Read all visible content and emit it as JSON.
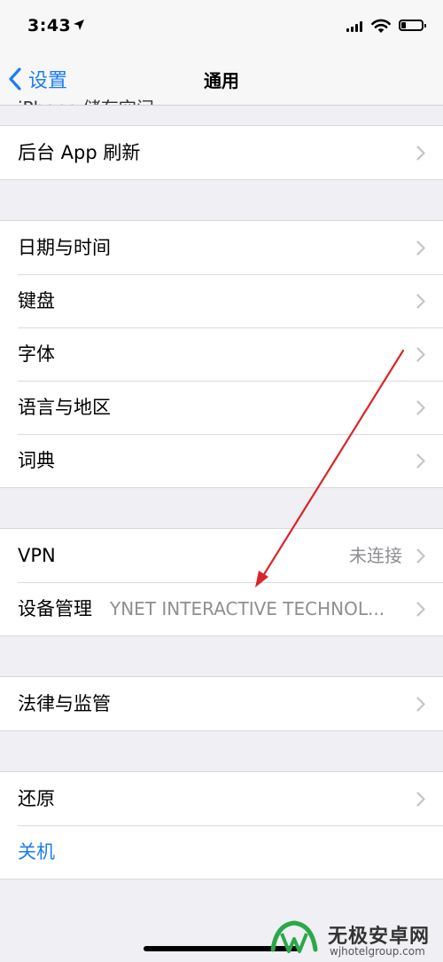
{
  "status_bar": {
    "time": "3:43"
  },
  "nav": {
    "back_label": "设置",
    "title": "通用",
    "clipped_item": "iPhone 储存空间"
  },
  "groups": [
    {
      "rows": [
        {
          "label": "后台 App 刷新",
          "value": ""
        }
      ]
    },
    {
      "rows": [
        {
          "label": "日期与时间",
          "value": ""
        },
        {
          "label": "键盘",
          "value": ""
        },
        {
          "label": "字体",
          "value": ""
        },
        {
          "label": "语言与地区",
          "value": ""
        },
        {
          "label": "词典",
          "value": ""
        }
      ]
    },
    {
      "rows": [
        {
          "label": "VPN",
          "value": "未连接"
        },
        {
          "label": "设备管理",
          "value": "YNET INTERACTIVE TECHNOL..."
        }
      ]
    },
    {
      "rows": [
        {
          "label": "法律与监管",
          "value": ""
        }
      ]
    },
    {
      "rows": [
        {
          "label": "还原",
          "value": ""
        },
        {
          "label": "关机",
          "value": ""
        }
      ]
    }
  ],
  "watermark": {
    "name": "无极安卓网",
    "url": "wjhotelgroup.com"
  },
  "colors": {
    "accent": "#1b7cf6",
    "annotation_arrow": "#d9262a",
    "background": "#efeff4"
  }
}
